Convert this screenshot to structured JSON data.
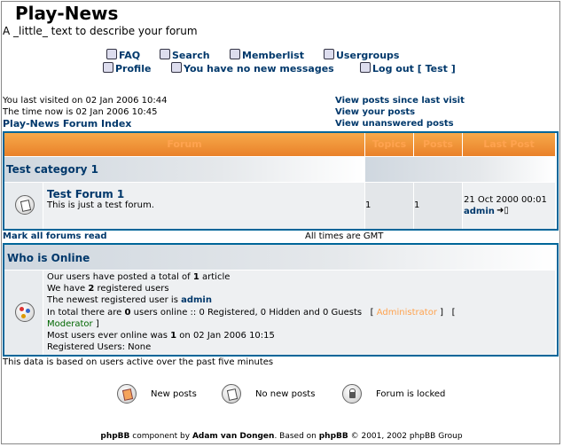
{
  "header": {
    "site_title": "Play-News",
    "site_desc": "A _little_ text to describe your forum"
  },
  "nav": {
    "faq": "FAQ",
    "search": "Search",
    "memberlist": "Memberlist",
    "usergroups": "Usergroups",
    "profile": "Profile",
    "messages": "You have no new messages",
    "logout": "Log out [ Test ]"
  },
  "status": {
    "last_visit": "You last visited on 02 Jan 2006 10:44",
    "time_now": "The time now is 02 Jan 2006 10:45",
    "view_since_last": "View posts since last visit",
    "view_yours": "View your posts",
    "view_unanswered": "View unanswered posts",
    "forum_index": "Play-News Forum Index"
  },
  "table": {
    "columns": [
      "Forum",
      "Topics",
      "Posts",
      "Last Post"
    ],
    "category": "Test category 1",
    "forum": {
      "name": "Test Forum 1",
      "desc": "This is just a test forum.",
      "topics": "1",
      "posts": "1",
      "last_post_date": "21 Oct 2000 00:01",
      "last_post_user": "admin"
    }
  },
  "below_table": {
    "mark_read": "Mark all forums read",
    "timezone": "All times are GMT"
  },
  "online": {
    "title": "Who is Online",
    "line1_pre": "Our users have posted a total of ",
    "line1_count": "1",
    "line1_post": " article",
    "line2_pre": "We have ",
    "line2_count": "2",
    "line2_post": " registered users",
    "line3_pre": "The newest registered user is ",
    "line3_user": "admin",
    "line4_pre": "In total there are ",
    "line4_count": "0",
    "line4_post": " users online :: 0 Registered, 0 Hidden and 0 Guests",
    "legend_admin": "Administrator",
    "legend_mod": "Moderator",
    "bracket_open": "[",
    "bracket_close": "]",
    "line5_pre": "Most users ever online was ",
    "line5_count": "1",
    "line5_post": " on 02 Jan 2006 10:15",
    "line6": "Registered Users: None",
    "based_on": "This data is based on users active over the past five minutes"
  },
  "legend": {
    "new_posts": "New posts",
    "no_new_posts": "No new posts",
    "locked": "Forum is locked"
  },
  "footer": {
    "phpbb": "phpBB",
    "component_by": " component by ",
    "author": "Adam van Dongen",
    "based_on": ". Based on ",
    "phpbb2": "phpBB",
    "copyright": " © 2001, 2002 phpBB Group"
  },
  "colors": {
    "link": "#00386b",
    "header_text": "#ffa34f",
    "border": "#006699",
    "admin": "#ffa34f",
    "moderator": "#006600"
  }
}
